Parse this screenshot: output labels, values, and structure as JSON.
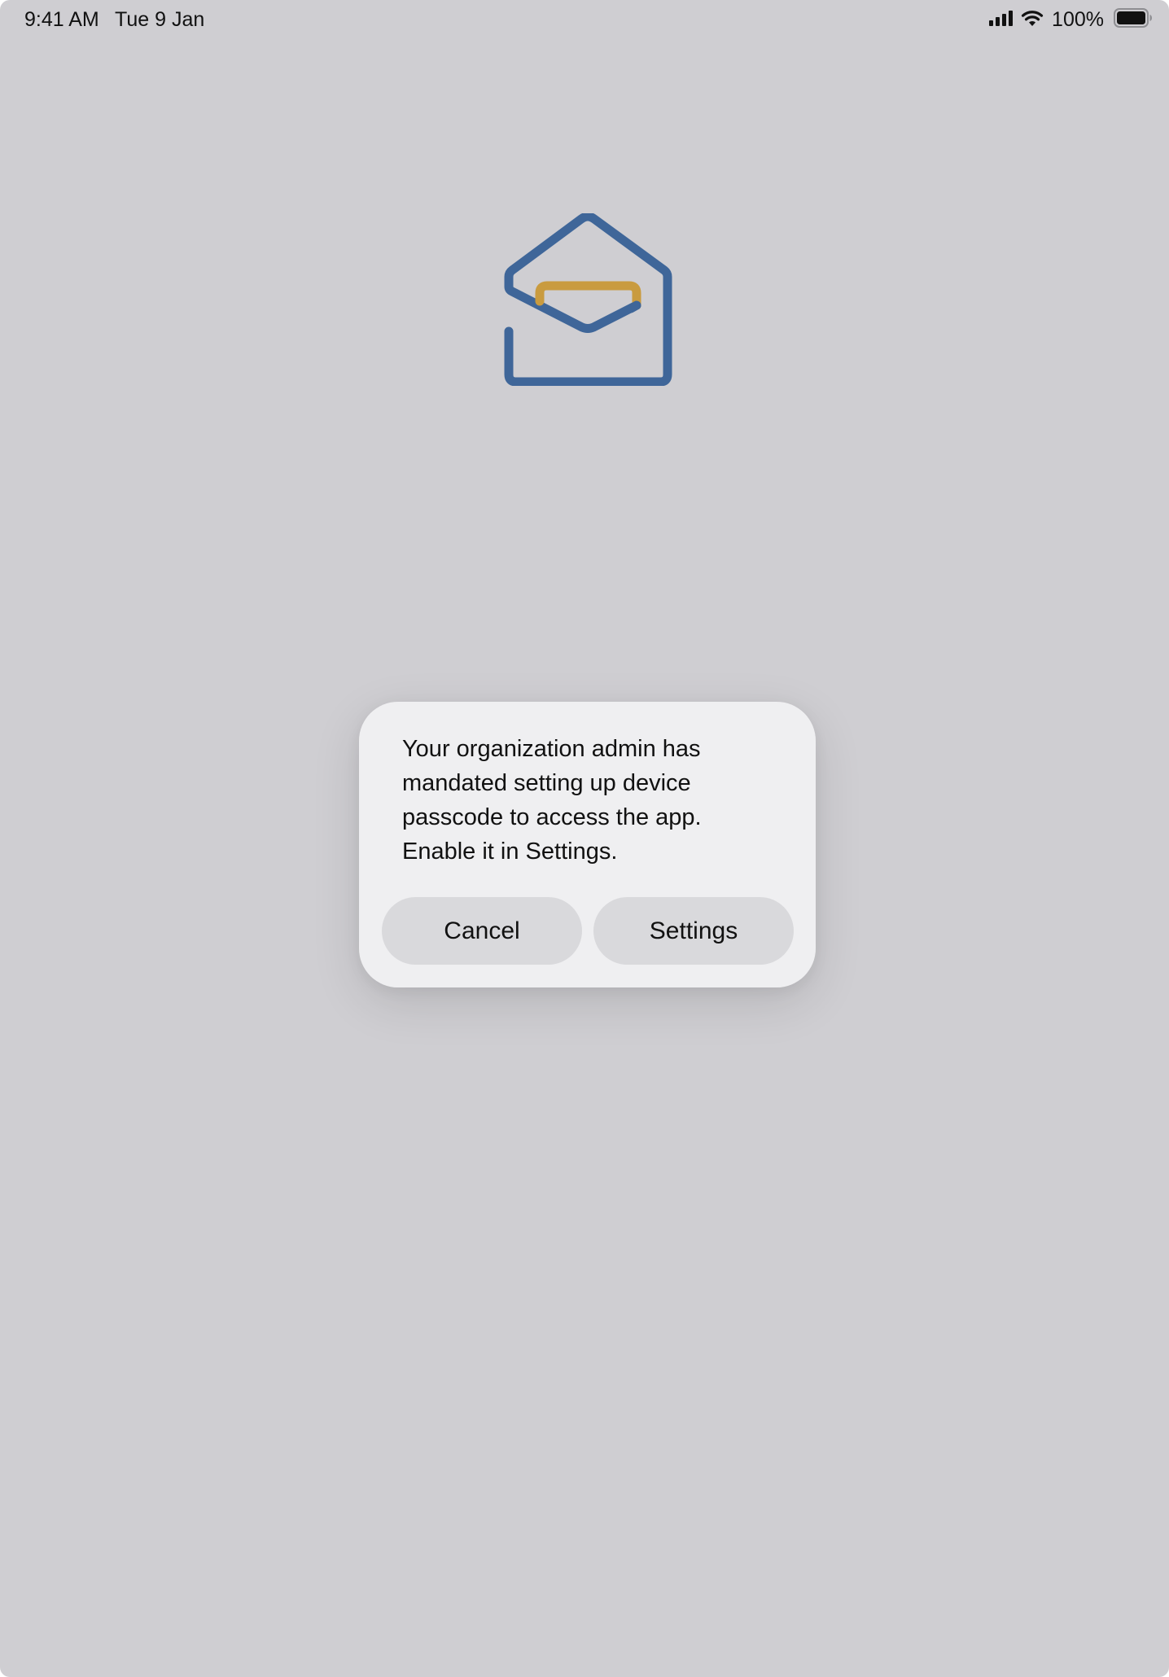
{
  "status_bar": {
    "time": "9:41 AM",
    "date": "Tue 9 Jan",
    "battery_percent": "100%",
    "signal_icon": "cellular-signal-icon",
    "wifi_icon": "wifi-icon",
    "battery_icon": "battery-icon"
  },
  "app": {
    "logo_icon": "zoho-mail-envelope-logo",
    "colors": {
      "background": "#cfced2",
      "logo_blue": "#3f6699",
      "logo_gold": "#c99b3f",
      "alert_background": "#efeff1",
      "button_background": "#d9d9dc"
    }
  },
  "alert": {
    "message": "Your organization admin has\nmandated setting up device\npasscode to access the app.\nEnable it in Settings.",
    "cancel_label": "Cancel",
    "settings_label": "Settings"
  }
}
